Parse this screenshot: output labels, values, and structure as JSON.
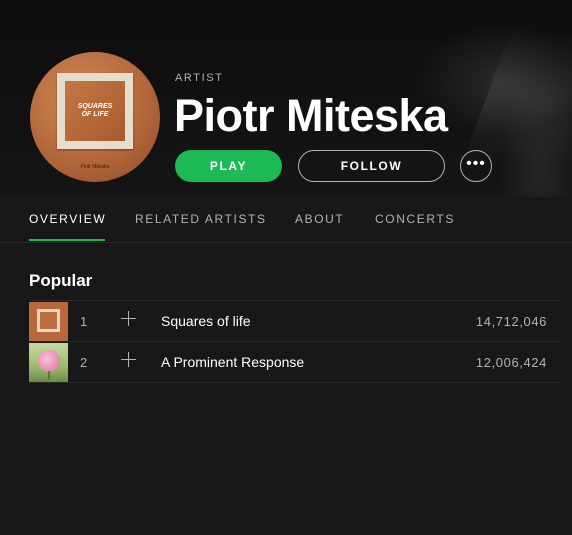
{
  "header": {
    "type_label": "ARTIST",
    "artist_name": "Piotr Miteska",
    "avatar": {
      "cover_text_line1": "SQUARES",
      "cover_text_line2": "OF LIFE",
      "cover_signature": "Piotr Miteska"
    },
    "play_label": "PLAY",
    "follow_label": "FOLLOW",
    "more_icon": "more-horizontal-icon"
  },
  "tabs": [
    {
      "label": "OVERVIEW",
      "active": true
    },
    {
      "label": "RELATED ARTISTS",
      "active": false
    },
    {
      "label": "ABOUT",
      "active": false
    },
    {
      "label": "CONCERTS",
      "active": false
    }
  ],
  "popular": {
    "title": "Popular",
    "tracks": [
      {
        "num": "1",
        "name": "Squares of life",
        "plays": "14,712,046",
        "add_icon": "plus-icon"
      },
      {
        "num": "2",
        "name": "A Prominent Response",
        "plays": "12,006,424",
        "add_icon": "plus-icon"
      }
    ]
  },
  "colors": {
    "accent_green": "#1db954",
    "background": "#181818",
    "muted_text": "#b3b3b3"
  }
}
